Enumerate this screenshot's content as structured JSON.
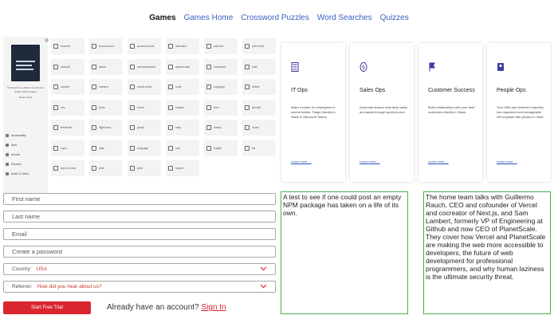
{
  "nav": {
    "items": [
      {
        "label": "Games",
        "active": true
      },
      {
        "label": "Games Home",
        "active": false
      },
      {
        "label": "Crossword Puzzles",
        "active": false
      },
      {
        "label": "Word Searches",
        "active": false
      },
      {
        "label": "Quizzes",
        "active": false
      }
    ]
  },
  "sidebar": {
    "book_caption": "Unlimited Free eBook: Get 30 Free Adobe Stock Images",
    "sub_caption": "Adobe Stock",
    "items": [
      "Accessibility",
      "Alert",
      "Arrows",
      "Devices",
      "Audio & Video"
    ]
  },
  "icon_grid": {
    "tiles": [
      "account",
      "account-box",
      "account-circle",
      "add-alert",
      "add-box",
      "add-circle",
      "android",
      "alarm",
      "announcement",
      "aspect-ratio",
      "bookmark",
      "build",
      "cached",
      "camera",
      "check-circle",
      "code",
      "copyright",
      "delete",
      "dns",
      "done",
      "event",
      "explore",
      "face",
      "favorite",
      "feedback",
      "flight-land",
      "grade",
      "help",
      "history",
      "home",
      "input",
      "label",
      "language",
      "lock",
      "loyalty",
      "list",
      "open-in-new",
      "pets",
      "print",
      "search"
    ]
  },
  "cards": [
    {
      "title": "IT Ops",
      "desc": "Make it easier for employees to submit tickets. Triage directly in Slack or Microsoft Teams.",
      "link": "Learn more →",
      "icon": "server-icon"
    },
    {
      "title": "Sales Ops",
      "desc": "Automate tedious deal desk tasks and assist through quote-to-end.",
      "link": "Learn more →",
      "icon": "dollar-icon"
    },
    {
      "title": "Customer Success",
      "desc": "Build relationships with your best customers directly in Slack.",
      "link": "Learn more →",
      "icon": "flag-icon"
    },
    {
      "title": "People Ops",
      "desc": "Turn DMs and cluttered channels into organized and manageable HR requests with privacy in mind.",
      "link": "Learn more →",
      "icon": "people-icon"
    }
  ],
  "form": {
    "first_name": "First name",
    "last_name": "Last name",
    "email": "Email",
    "password": "Create a password",
    "country_label": "Country:",
    "country_value": "USA",
    "referrer_label": "Referrer:",
    "referrer_value": "How did you hear about us?",
    "cta": "Start Free Trial",
    "have_account": "Already have an account?",
    "sign_in": "Sign In"
  },
  "panels": {
    "left": "A test to see if one could post an empty NPM package has taken on a life of its own.",
    "right": "The home team talks with Guillermo Rauch, CEO and cofounder of Vercel and cocreator of Next.js, and Sam Lambert, formerly VP of Engineering at Github and now CEO of PlanetScale. They cover how Vercel and PlanetScale are making the web more accessible to developers, the future of web development for professional programmers, and why human laziness is the ultimate security threat."
  },
  "colors": {
    "nav_link": "#3b5ec2",
    "cta_red": "#d9262e",
    "panel_border": "#4caf50",
    "card_link": "#2a4fb5"
  }
}
